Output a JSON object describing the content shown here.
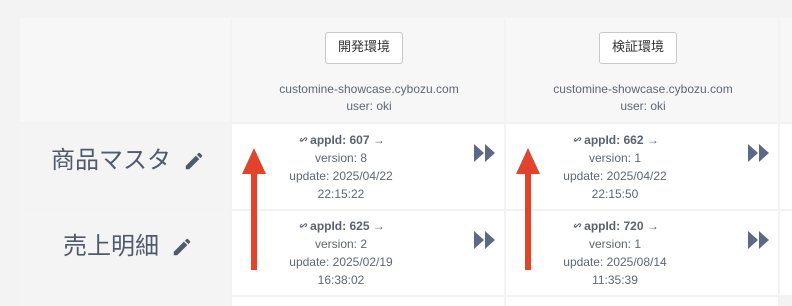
{
  "environments": [
    {
      "button_label": "開発環境",
      "domain": "customine-showcase.cybozu.com",
      "user": "user: oki"
    },
    {
      "button_label": "検証環境",
      "domain": "customine-showcase.cybozu.com",
      "user": "user: oki"
    }
  ],
  "apps": [
    {
      "name": "商品マスタ",
      "deployments": [
        {
          "app_id": "appId: 607",
          "arrow": "→",
          "version": "version: 8",
          "update_date": "update: 2025/04/22",
          "update_time": "22:15:22"
        },
        {
          "app_id": "appId: 662",
          "arrow": "→",
          "version": "version: 1",
          "update_date": "update: 2025/04/22",
          "update_time": "22:15:50"
        }
      ]
    },
    {
      "name": "売上明細",
      "deployments": [
        {
          "app_id": "appId: 625",
          "arrow": "→",
          "version": "version: 2",
          "update_date": "update: 2025/02/19",
          "update_time": "16:38:02"
        },
        {
          "app_id": "appId: 720",
          "arrow": "→",
          "version": "version: 1",
          "update_date": "update: 2025/08/14",
          "update_time": "11:35:39"
        }
      ]
    }
  ],
  "colors": {
    "annotation_arrow": "#e2432a",
    "icon": "#5a6a85",
    "border": "#dcdcdc"
  },
  "icons": {
    "edit": "pencil-icon",
    "link": "link-icon",
    "deploy": "fast-forward-icon"
  }
}
